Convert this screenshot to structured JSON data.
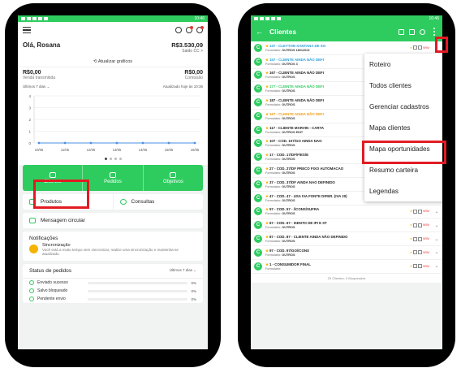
{
  "status_bar": {
    "time": "10:46"
  },
  "home": {
    "user_name": "Olá, Rosana",
    "saldo_value": "R$3.530,09",
    "saldo_label": "Saldo CC >",
    "update_label": "Atualizar gráficos",
    "kpi_left_value": "R$0,00",
    "kpi_left_label": "Venda transmitida",
    "kpi_right_value": "R$0,00",
    "kpi_right_label": "Comissão",
    "filter_label": "Últimos 7 dias",
    "updated_label": "Atualizado hoje às 10:36",
    "nav": {
      "clientes": "Clientes",
      "pedidos": "Pedidos",
      "objetivos": "Objetivos"
    },
    "produtos": "Produtos",
    "consultas": "Consultas",
    "mensagem": "Mensagem circular",
    "notif_title": "Notificações",
    "notif_item_title": "Sincronização",
    "notif_item_desc": "Você está a muito tempo sem sincronizar, realize uma sincronização e mantenha-se atualizado.",
    "status_title": "Status de pedidos",
    "status_filter": "Últimos 7 dias",
    "status_rows": [
      {
        "label": "Enviado sucesso",
        "pct": "0%"
      },
      {
        "label": "Salvo bloqueado",
        "pct": "0%"
      },
      {
        "label": "Pendente envio",
        "pct": "0%"
      }
    ]
  },
  "chart_data": {
    "type": "line",
    "categories": [
      "10/05",
      "11/05",
      "12/05",
      "13/05",
      "14/05",
      "15/05",
      "16/05"
    ],
    "values": [
      0,
      0,
      0,
      0,
      0,
      0,
      0
    ],
    "y_ticks": [
      "0",
      "1",
      "2",
      "3",
      "4"
    ],
    "ylim": [
      0,
      4
    ],
    "colors": {
      "line": "#4a90e2"
    }
  },
  "clientes": {
    "title": "Clientes",
    "footer": "25 Clientes, 0 Bloqueados",
    "rows": [
      {
        "code": "137",
        "name": "137 - CLEYTON SANTANA DE SO",
        "sub_label": "Formulário:",
        "sub_value": "OUTROS 18012023",
        "color": "blue"
      },
      {
        "code": "157",
        "name": "157 - CLIENTE AINDA NÃO DEFI",
        "sub_label": "Formulário:",
        "sub_value": "OUTROS 3",
        "color": "blue"
      },
      {
        "code": "167",
        "name": "167 - CLIENTE AINDA NÃO DEFI",
        "sub_label": "Formulário:",
        "sub_value": "OUTROS",
        "color": "dark"
      },
      {
        "code": "177",
        "name": "177 - CLIENTE AINDA NÃO DEFI",
        "sub_label": "Formulário:",
        "sub_value": "OUTROS",
        "color": "green"
      },
      {
        "code": "187",
        "name": "187 - CLIENTE AINDA NÃO DEFI",
        "sub_label": "Formulário:",
        "sub_value": "OUTROS",
        "color": "dark"
      },
      {
        "code": "197",
        "name": "197 - CLIENTE AINDA NÃO DEFI",
        "sub_label": "Formulário:",
        "sub_value": "OUTROS",
        "color": "orange"
      },
      {
        "code": "117",
        "name": "117 - CLIENTE MARVIN - CARTA",
        "sub_label": "Formulário:",
        "sub_value": "OUTROS EDIT",
        "color": "dark"
      },
      {
        "code": "107",
        "name": "107 - COD. 107/GO AINDA NAO",
        "sub_label": "Formulário:",
        "sub_value": "OUTROS",
        "color": "dark"
      },
      {
        "code": "17",
        "name": "17 - COD. 17/DF/F/ES/E",
        "sub_label": "Formulário:",
        "sub_value": "OUTROS",
        "color": "dark"
      },
      {
        "code": "27",
        "name": "27 - COD. 27/DF PRECO FIXO AUTOMACAO",
        "sub_label": "Formulário:",
        "sub_value": "OUTROS",
        "color": "dark"
      },
      {
        "code": "37",
        "name": "37 - COD. 37/DF AINDA NAO DEFINIDO",
        "sub_label": "Formulário:",
        "sub_value": "OUTROS",
        "color": "dark"
      },
      {
        "code": "47",
        "name": "47 - COD. 47 - USA IVA FONTE DIFER. (IVA 20)",
        "sub_label": "Formulário:",
        "sub_value": "OUTROS",
        "color": "dark"
      },
      {
        "code": "57",
        "name": "57 - COD. 57 - //CONS/SUFRA",
        "sub_label": "Formulário:",
        "sub_value": "OUTROS",
        "color": "dark"
      },
      {
        "code": "67",
        "name": "67 - COD. 67 - ISENTO DE IPI E ST",
        "sub_label": "Formulário:",
        "sub_value": "OUTROS",
        "color": "dark"
      },
      {
        "code": "87",
        "name": "87 - COD. 87 - CLIENTE AINDA NÃO DEFINIDO",
        "sub_label": "Formulário:",
        "sub_value": "OUTROS",
        "color": "dark"
      },
      {
        "code": "97",
        "name": "97 - COD. 97/GO//CONS",
        "sub_label": "Formulário:",
        "sub_value": "OUTROS",
        "color": "dark"
      },
      {
        "code": "1",
        "name": "1 - CONSUMIDOR FINAL",
        "sub_label": "Formulário:",
        "sub_value": "",
        "color": "dark"
      }
    ],
    "row_tag": "NRM",
    "menu": [
      "Roteiro",
      "Todos clientes",
      "Gerenciar cadastros",
      "Mapa clientes",
      "Mapa oportunidades",
      "Resumo carteira",
      "Legendas"
    ]
  },
  "colors": {
    "brand": "#2ecc5f",
    "highlight": "#e21b23"
  }
}
